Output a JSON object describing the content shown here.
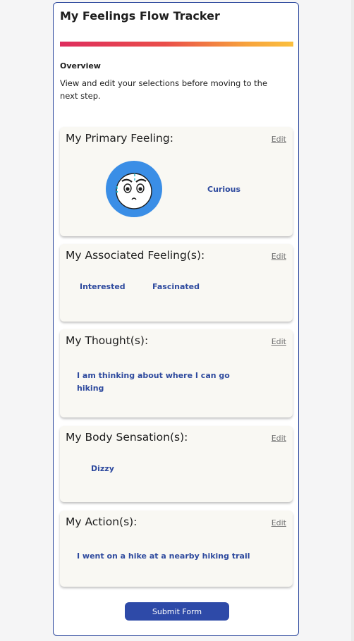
{
  "app": {
    "title": "My Feelings Flow Tracker"
  },
  "overview": {
    "heading": "Overview",
    "text": "View and edit your selections before moving to the next step."
  },
  "sections": {
    "primary": {
      "title": "My Primary Feeling:",
      "edit_label": "Edit",
      "feeling": "Curious",
      "icon": "curious-face-icon"
    },
    "associated": {
      "title": "My Associated Feeling(s):",
      "edit_label": "Edit",
      "feelings": [
        "Interested",
        "Fascinated"
      ]
    },
    "thoughts": {
      "title": "My Thought(s):",
      "edit_label": "Edit",
      "items": [
        "I am thinking about where I can go hiking"
      ]
    },
    "body": {
      "title": "My Body Sensation(s):",
      "edit_label": "Edit",
      "items": [
        "Dizzy"
      ]
    },
    "actions": {
      "title": "My Action(s):",
      "edit_label": "Edit",
      "items": [
        "I went on a hike at a nearby hiking trail"
      ]
    }
  },
  "submit": {
    "label": "Submit Form"
  },
  "colors": {
    "accent": "#2e4aa8",
    "value_text": "#2e4a9e",
    "emoji_bg": "#3a8ee6",
    "section_bg": "#f9f8f3"
  }
}
